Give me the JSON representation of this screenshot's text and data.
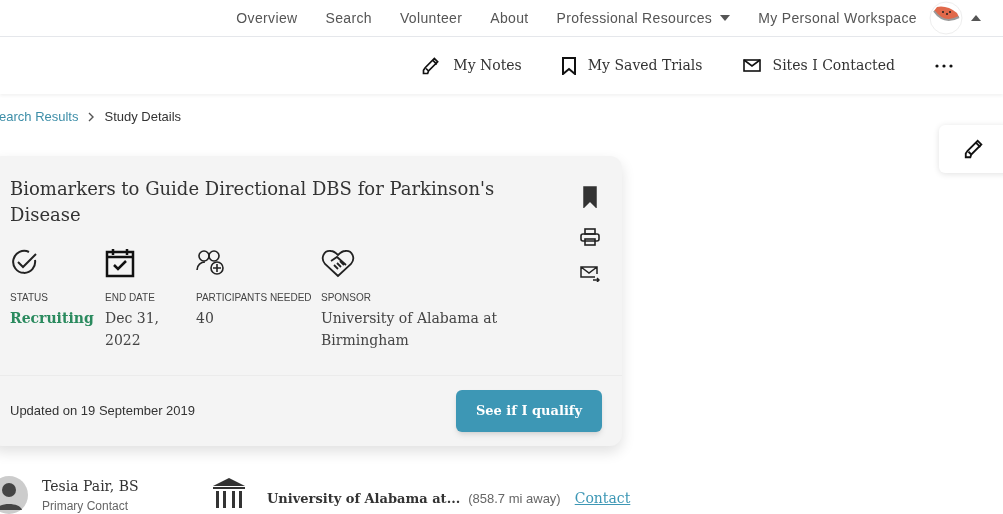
{
  "nav": {
    "links": [
      {
        "label": "Overview",
        "kind": "link"
      },
      {
        "label": "Search",
        "kind": "link"
      },
      {
        "label": "Volunteer",
        "kind": "link"
      },
      {
        "label": "About",
        "kind": "link"
      },
      {
        "label": "Professional Resources",
        "kind": "dropdown"
      },
      {
        "label": "My Personal Workspace",
        "kind": "link"
      }
    ]
  },
  "toolbar": {
    "items": [
      {
        "label": "My Notes",
        "kind": "notes"
      },
      {
        "label": "My Saved Trials",
        "kind": "saved"
      },
      {
        "label": "Sites I Contacted",
        "kind": "contacted"
      }
    ]
  },
  "breadcrumb": [
    {
      "label": "earch Results",
      "kind": "link"
    },
    {
      "label": "Study Details",
      "kind": "current"
    }
  ],
  "study": {
    "title": "Biomarkers to Guide Directional DBS for Parkinson's Disease",
    "bookmarked": true,
    "facts": [
      {
        "kind": "status",
        "label": "STATUS",
        "value": "Recruiting"
      },
      {
        "kind": "date",
        "label": "END DATE",
        "value": "Dec 31, 2022"
      },
      {
        "kind": "participants",
        "label": "PARTICIPANTS NEEDED",
        "value": "40"
      },
      {
        "kind": "sponsor",
        "label": "SPONSOR",
        "value": "University of Alabama at Birmingham"
      }
    ],
    "updated": "Updated on 19 September 2019",
    "button": "See if I qualify"
  },
  "contact": {
    "name": "Tesia Pair, BS",
    "role": "Primary Contact",
    "site": "University of Alabama at...",
    "distance": "(858.7 mi away)",
    "link": "Contact"
  }
}
